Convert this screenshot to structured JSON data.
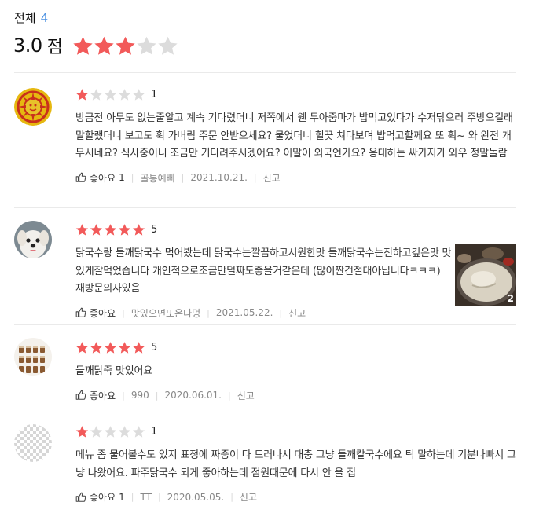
{
  "summary": {
    "label": "전체",
    "count": "4",
    "score": "3.0",
    "score_unit": "점",
    "rating": 3,
    "max_rating": 5
  },
  "colors": {
    "star_on": "#f25a5a",
    "star_off": "#dcdcdc",
    "count_blue": "#4a90e2"
  },
  "reviews": [
    {
      "rating": 1,
      "rating_label": "1",
      "text": "방금전  아무도 없는줄알고 계속 기다렸더니 저쪽에서  웬 두아줌마가 밥먹고있다가 수저닦으러 주방오길래 말할랬더니 보고도 휙 가버림 주문 안받으세요? 물었더니 힐끗 쳐다보며 밥먹고할께요 또 휙~ 와 완전 개무시네요? 식사중이니 조금만 기다려주시겠어요? 이말이  외국언가요? 응대하는 싸가지가  와우 정말놀람",
      "like_label": "좋아요",
      "like_count": "1",
      "author": "골통예삐",
      "date": "2021.10.21.",
      "report": "신고",
      "avatar_icon": "sun-pattern-avatar"
    },
    {
      "rating": 5,
      "rating_label": "5",
      "text": "닭국수랑 들깨닭국수 먹어봤는데  닭국수는깔끔하고시원한맛 들깨닭국수는진하고깊은맛 맛있게잘먹었습니다  개인적으로조금만덜짜도좋을거같은데 (많이짠건절대아닙니다ㅋㅋㅋ) 재방문의사있음",
      "like_label": "좋아요",
      "like_count": "",
      "author": "맛있으면또온다멍",
      "date": "2021.05.22.",
      "report": "신고",
      "photo_count": "2",
      "avatar_icon": "dog-avatar"
    },
    {
      "rating": 5,
      "rating_label": "5",
      "text": "들깨닭죽 맛있어요",
      "like_label": "좋아요",
      "like_count": "",
      "author": "990",
      "date": "2020.06.01.",
      "report": "신고",
      "avatar_icon": "drinks-avatar"
    },
    {
      "rating": 1,
      "rating_label": "1",
      "text": "메뉴 좀 물어볼수도 있지 표정에 짜증이 다 드러나서 대충 그냥 들깨칼국수에요 틱 말하는데 기분나빠서 그냥 나왔어요. 파주닭국수 되게 좋아하는데 점원때문에 다시 안 올 집",
      "like_label": "좋아요",
      "like_count": "1",
      "author": "TT",
      "date": "2020.05.05.",
      "report": "신고",
      "avatar_icon": "placeholder-avatar"
    }
  ]
}
